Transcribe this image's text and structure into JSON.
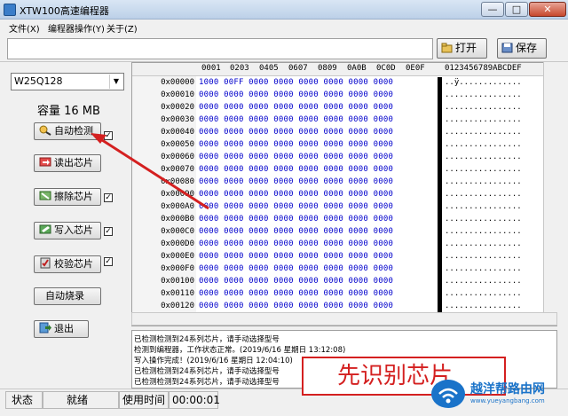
{
  "window": {
    "title": "XTW100高速编程器",
    "min_label": "—",
    "max_label": "□",
    "close_label": "✕"
  },
  "menu": [
    "文件(X)",
    "编程器操作(Y)",
    "关于(Z)"
  ],
  "toolbar": {
    "open_label": "打开",
    "save_label": "保存"
  },
  "left": {
    "chip": "W25Q128",
    "capacity": "容量 16 MB",
    "buttons": [
      {
        "label": "自动检测",
        "checked": true
      },
      {
        "label": "读出芯片",
        "checked": false
      },
      {
        "label": "擦除芯片",
        "checked": true
      },
      {
        "label": "写入芯片",
        "checked": true
      },
      {
        "label": "校验芯片",
        "checked": true
      },
      {
        "label": "自动烧录",
        "checked": false
      },
      {
        "label": "退出",
        "checked": false
      }
    ]
  },
  "hex": {
    "header_cols": [
      "0001",
      "0203",
      "0405",
      "0607",
      "0809",
      "0A0B",
      "0C0D",
      "0E0F"
    ],
    "ascii_header": "0123456789ABCDEF",
    "rows": [
      {
        "addr": "0x00000",
        "hex": "1000 00FF 0000 0000 0000 0000 0000 0000",
        "ascii": "..ÿ............."
      },
      {
        "addr": "0x00010",
        "hex": "0000 0000 0000 0000 0000 0000 0000 0000",
        "ascii": "................"
      },
      {
        "addr": "0x00020",
        "hex": "0000 0000 0000 0000 0000 0000 0000 0000",
        "ascii": "................"
      },
      {
        "addr": "0x00030",
        "hex": "0000 0000 0000 0000 0000 0000 0000 0000",
        "ascii": "................"
      },
      {
        "addr": "0x00040",
        "hex": "0000 0000 0000 0000 0000 0000 0000 0000",
        "ascii": "................"
      },
      {
        "addr": "0x00050",
        "hex": "0000 0000 0000 0000 0000 0000 0000 0000",
        "ascii": "................"
      },
      {
        "addr": "0x00060",
        "hex": "0000 0000 0000 0000 0000 0000 0000 0000",
        "ascii": "................"
      },
      {
        "addr": "0x00070",
        "hex": "0000 0000 0000 0000 0000 0000 0000 0000",
        "ascii": "................"
      },
      {
        "addr": "0x00080",
        "hex": "0000 0000 0000 0000 0000 0000 0000 0000",
        "ascii": "................"
      },
      {
        "addr": "0x00090",
        "hex": "0000 0000 0000 0000 0000 0000 0000 0000",
        "ascii": "................"
      },
      {
        "addr": "0x000A0",
        "hex": "0000 0000 0000 0000 0000 0000 0000 0000",
        "ascii": "................"
      },
      {
        "addr": "0x000B0",
        "hex": "0000 0000 0000 0000 0000 0000 0000 0000",
        "ascii": "................"
      },
      {
        "addr": "0x000C0",
        "hex": "0000 0000 0000 0000 0000 0000 0000 0000",
        "ascii": "................"
      },
      {
        "addr": "0x000D0",
        "hex": "0000 0000 0000 0000 0000 0000 0000 0000",
        "ascii": "................"
      },
      {
        "addr": "0x000E0",
        "hex": "0000 0000 0000 0000 0000 0000 0000 0000",
        "ascii": "................"
      },
      {
        "addr": "0x000F0",
        "hex": "0000 0000 0000 0000 0000 0000 0000 0000",
        "ascii": "................"
      },
      {
        "addr": "0x00100",
        "hex": "0000 0000 0000 0000 0000 0000 0000 0000",
        "ascii": "................"
      },
      {
        "addr": "0x00110",
        "hex": "0000 0000 0000 0000 0000 0000 0000 0000",
        "ascii": "................"
      },
      {
        "addr": "0x00120",
        "hex": "0000 0000 0000 0000 0000 0000 0000 0000",
        "ascii": "................"
      }
    ]
  },
  "log": [
    "已检测检测到24系列芯片，请手动选择型号",
    "检测到编程器，工作状态正常。(2019/6/16 星期日 13:12:08)",
    "写入操作完成！(2019/6/16 星期日 12:04:10)",
    "已检测检测到24系列芯片，请手动选择型号",
    "已检测检测到24系列芯片，请手动选择型号"
  ],
  "status": {
    "label": "状态",
    "value": "就绪",
    "time_label": "使用时间",
    "time": "00:00:01"
  },
  "callout": "先识别芯片",
  "watermark": {
    "title": "越洋帮路由网",
    "url": "www.yueyangbang.com"
  },
  "colors": {
    "hex_value": "#0000cc",
    "arrow": "#d42020",
    "callout": "#d42020",
    "brand": "#1a73c9"
  }
}
